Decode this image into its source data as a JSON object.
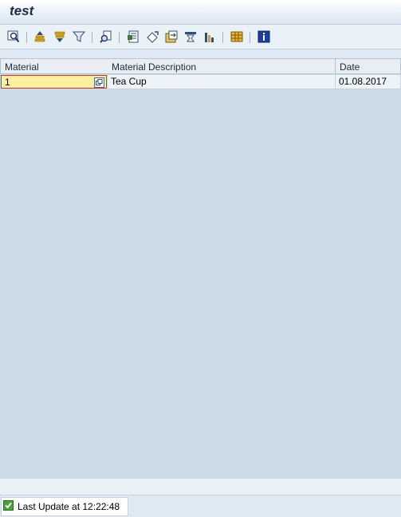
{
  "window": {
    "title": "test"
  },
  "toolbar": {
    "buttons": [
      {
        "icon": "details-icon",
        "label": ""
      },
      {
        "icon": "sort-ascending-icon",
        "label": ""
      },
      {
        "icon": "sort-descending-icon",
        "label": ""
      },
      {
        "icon": "filter-icon",
        "label": ""
      },
      {
        "icon": "find-icon",
        "label": ""
      },
      {
        "icon": "export-icon",
        "label": ""
      },
      {
        "icon": "mail-recipient-icon",
        "label": ""
      },
      {
        "icon": "local-file-icon",
        "label": ""
      },
      {
        "icon": "abc-analysis-icon",
        "label": ""
      },
      {
        "icon": "graphic-icon",
        "label": ""
      },
      {
        "icon": "layout-icon",
        "label": ""
      },
      {
        "icon": "info-icon",
        "label": ""
      }
    ]
  },
  "grid": {
    "columns": [
      "Material",
      "Material Description",
      "Date"
    ],
    "rows": [
      {
        "material": "1",
        "description": "Tea Cup",
        "date": "01.08.2017"
      }
    ]
  },
  "status": {
    "message": "Last Update at 12:22:48",
    "type": "success"
  },
  "colors": {
    "accent": "#1a2c45",
    "input_highlight": "#fff0a0",
    "required_mark": "#d03030",
    "success": "#4aa33a"
  }
}
